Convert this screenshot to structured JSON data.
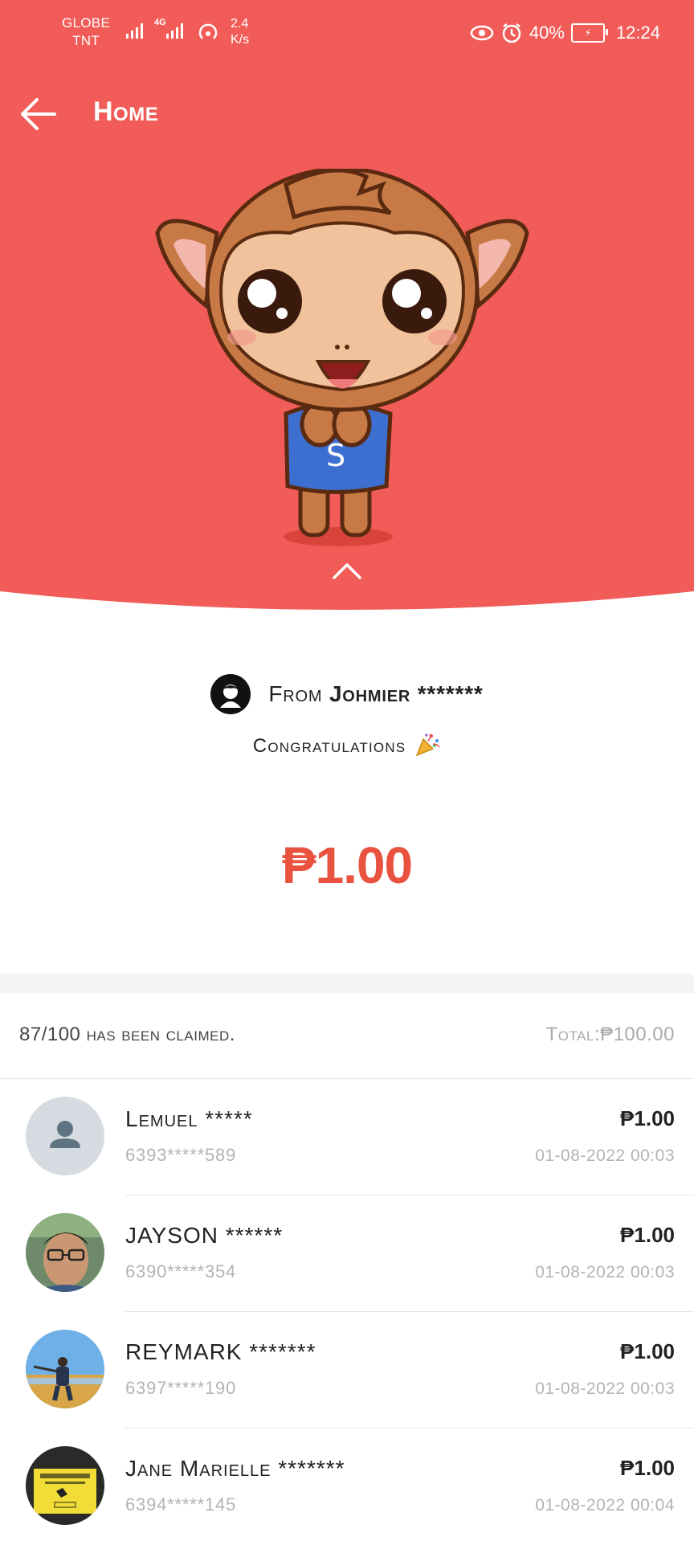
{
  "status_bar": {
    "carrier_1": "GLOBE",
    "carrier_2": "TNT",
    "network_type": "4G",
    "speed_value": "2.4",
    "speed_unit": "K/s",
    "battery": "40%",
    "time": "12:24"
  },
  "header": {
    "title": "Home"
  },
  "sender": {
    "prefix": "From",
    "name": "Johmier",
    "masked": "*******"
  },
  "congrats": "Congratulations",
  "amount": "₱1.00",
  "summary": {
    "claimed": "87/100 has been claimed.",
    "total": "Total:₱100.00"
  },
  "claims": [
    {
      "name": "Lemuel *****",
      "phone": "6393*****589",
      "amount": "₱1.00",
      "time": "01-08-2022 00:03"
    },
    {
      "name": "JAYSON ******",
      "phone": "6390*****354",
      "amount": "₱1.00",
      "time": "01-08-2022 00:03"
    },
    {
      "name": "REYMARK *******",
      "phone": "6397*****190",
      "amount": "₱1.00",
      "time": "01-08-2022 00:03"
    },
    {
      "name": "Jane Marielle *******",
      "phone": "6394*****145",
      "amount": "₱1.00",
      "time": "01-08-2022 00:04"
    }
  ],
  "icons": {
    "back": "arrow-left-icon",
    "chevron": "chevron-up-icon",
    "party": "party-popper-icon",
    "default_avatar": "person-icon"
  },
  "colors": {
    "header_background": "#F25C58",
    "amount_red": "#E9523F",
    "muted_text": "#B3B3B3"
  }
}
